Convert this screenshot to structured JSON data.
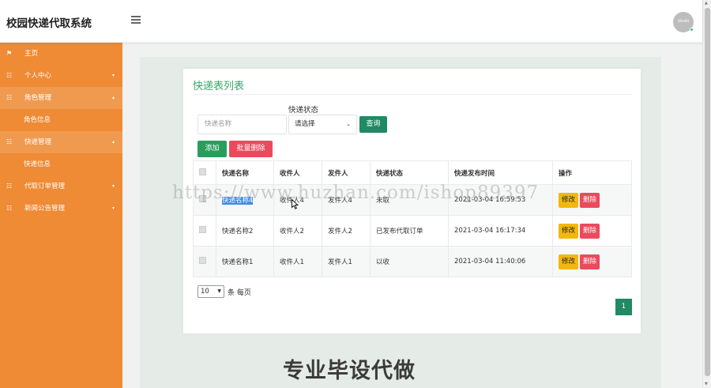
{
  "app": {
    "title": "校园快递代取系统",
    "avatar_text": "80x80"
  },
  "sidebar": {
    "items": [
      {
        "icon": "⚑",
        "label": "主页"
      },
      {
        "icon": "☷",
        "label": "个人中心",
        "caret": "▾"
      },
      {
        "icon": "☷",
        "label": "角色管理",
        "caret": "▴",
        "sub": [
          "角色信息"
        ]
      },
      {
        "icon": "☷",
        "label": "快递管理",
        "caret": "▴",
        "sub": [
          "快递信息"
        ]
      },
      {
        "icon": "☷",
        "label": "代取订单管理",
        "caret": "▾"
      },
      {
        "icon": "☷",
        "label": "新闻公告管理",
        "caret": "▾"
      }
    ]
  },
  "card": {
    "title": "快递表列表",
    "filter": {
      "status_label": "快递状态",
      "name_placeholder": "快递名称",
      "status_value": "请选择",
      "search_label": "查询"
    },
    "toolbar": {
      "add_label": "添加",
      "batch_delete_label": "批量删除"
    },
    "table": {
      "headers": [
        "快递名称",
        "收件人",
        "发件人",
        "快递状态",
        "快递发布时间",
        "操作"
      ],
      "rows": [
        {
          "name": "快递名称4",
          "receiver": "收件人4",
          "sender": "发件人4",
          "status": "未取",
          "time": "2021-03-04 16:59:53"
        },
        {
          "name": "快递名称2",
          "receiver": "收件人2",
          "sender": "发件人2",
          "status": "已发布代取订单",
          "time": "2021-03-04 16:17:34"
        },
        {
          "name": "快递名称1",
          "receiver": "收件人1",
          "sender": "发件人1",
          "status": "以收",
          "time": "2021-03-04 11:40:06"
        }
      ],
      "edit_label": "修改",
      "delete_label": "删除"
    },
    "pagination": {
      "page_size": "10",
      "suffix": "条 每页",
      "current_page": "1"
    }
  },
  "overlay": {
    "url_watermark": "https://www.huzhan.com/ishop89397",
    "text_watermark": "专业毕设代做"
  },
  "colors": {
    "sidebar": "#ef8a35",
    "accent_green": "#1f8a64",
    "danger": "#eb4a5d",
    "warning": "#f3b80d"
  }
}
